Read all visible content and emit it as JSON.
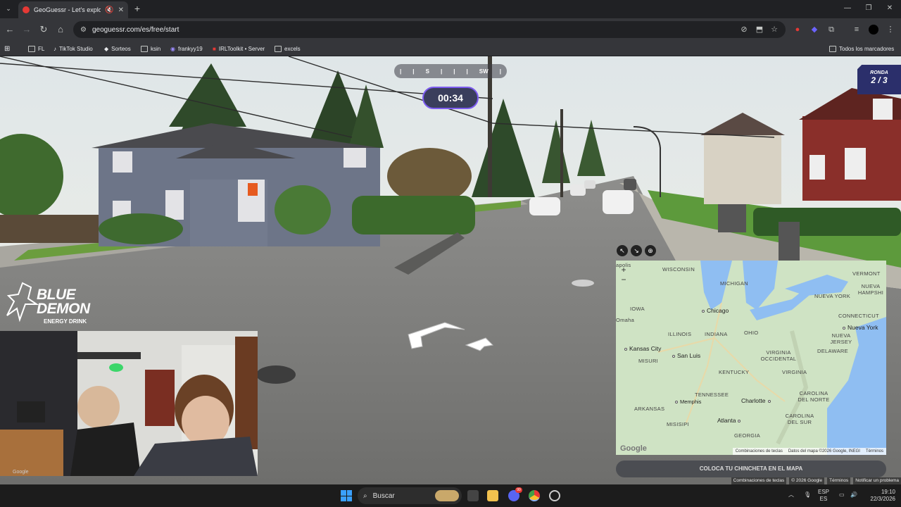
{
  "browser": {
    "tab_title": "GeoGuessr - Let's explore th",
    "url": "geoguessr.com/es/free/start",
    "bookmarks": [
      "FL",
      "TikTok Studio",
      "Sorteos",
      "ksin",
      "frankyy19",
      "IRLToolkit • Server",
      "excels"
    ],
    "all_bookmarks": "Todos los marcadores"
  },
  "game": {
    "compass": [
      "S",
      "SW"
    ],
    "timer": "00:34",
    "round_label": "RONDA",
    "round_value": "2 / 3",
    "place_pin_button": "COLOCA TU CHINCHETA EN EL MAPA",
    "scene_footer": [
      "Combinaciones de teclas",
      "© 2026 Google",
      "Términos",
      "Notificar un problema"
    ]
  },
  "sponsor": {
    "line1": "BLUE",
    "line2": "DEMON",
    "line3": "ENERGY DRINK"
  },
  "webcam": {
    "watermark": "Google"
  },
  "map": {
    "regions": [
      "WISCONSIN",
      "MICHIGAN",
      "IOWA",
      "Omaha",
      "ILLINOIS",
      "INDIANA",
      "OHIO",
      "MISURI",
      "VIRGINIA OCCIDENTAL",
      "KENTUCKY",
      "VIRGINIA",
      "TENNESSEE",
      "ARKANSAS",
      "CAROLINA DEL NORTE",
      "MISISIPI",
      "CAROLINA DEL SUR",
      "GEORGIA",
      "VERMONT",
      "NUEVA HAMPSHI",
      "NUEVA YORK",
      "CONNECTICUT",
      "NUEVA JERSEY",
      "DELAWARE",
      "apolis"
    ],
    "cities": [
      "Chicago",
      "Kansas City",
      "San Luis",
      "Nueva York",
      "Memphis",
      "Charlotte",
      "Atlanta"
    ],
    "logo": "Google",
    "footer": [
      "Combinaciones de teclas",
      "Datos del mapa ©2026 Google, INEGI",
      "Términos"
    ]
  },
  "taskbar": {
    "search_placeholder": "Buscar",
    "lang1": "ESP",
    "lang2": "ES",
    "time": "19:10",
    "date": "22/3/2026",
    "badge": "99"
  }
}
